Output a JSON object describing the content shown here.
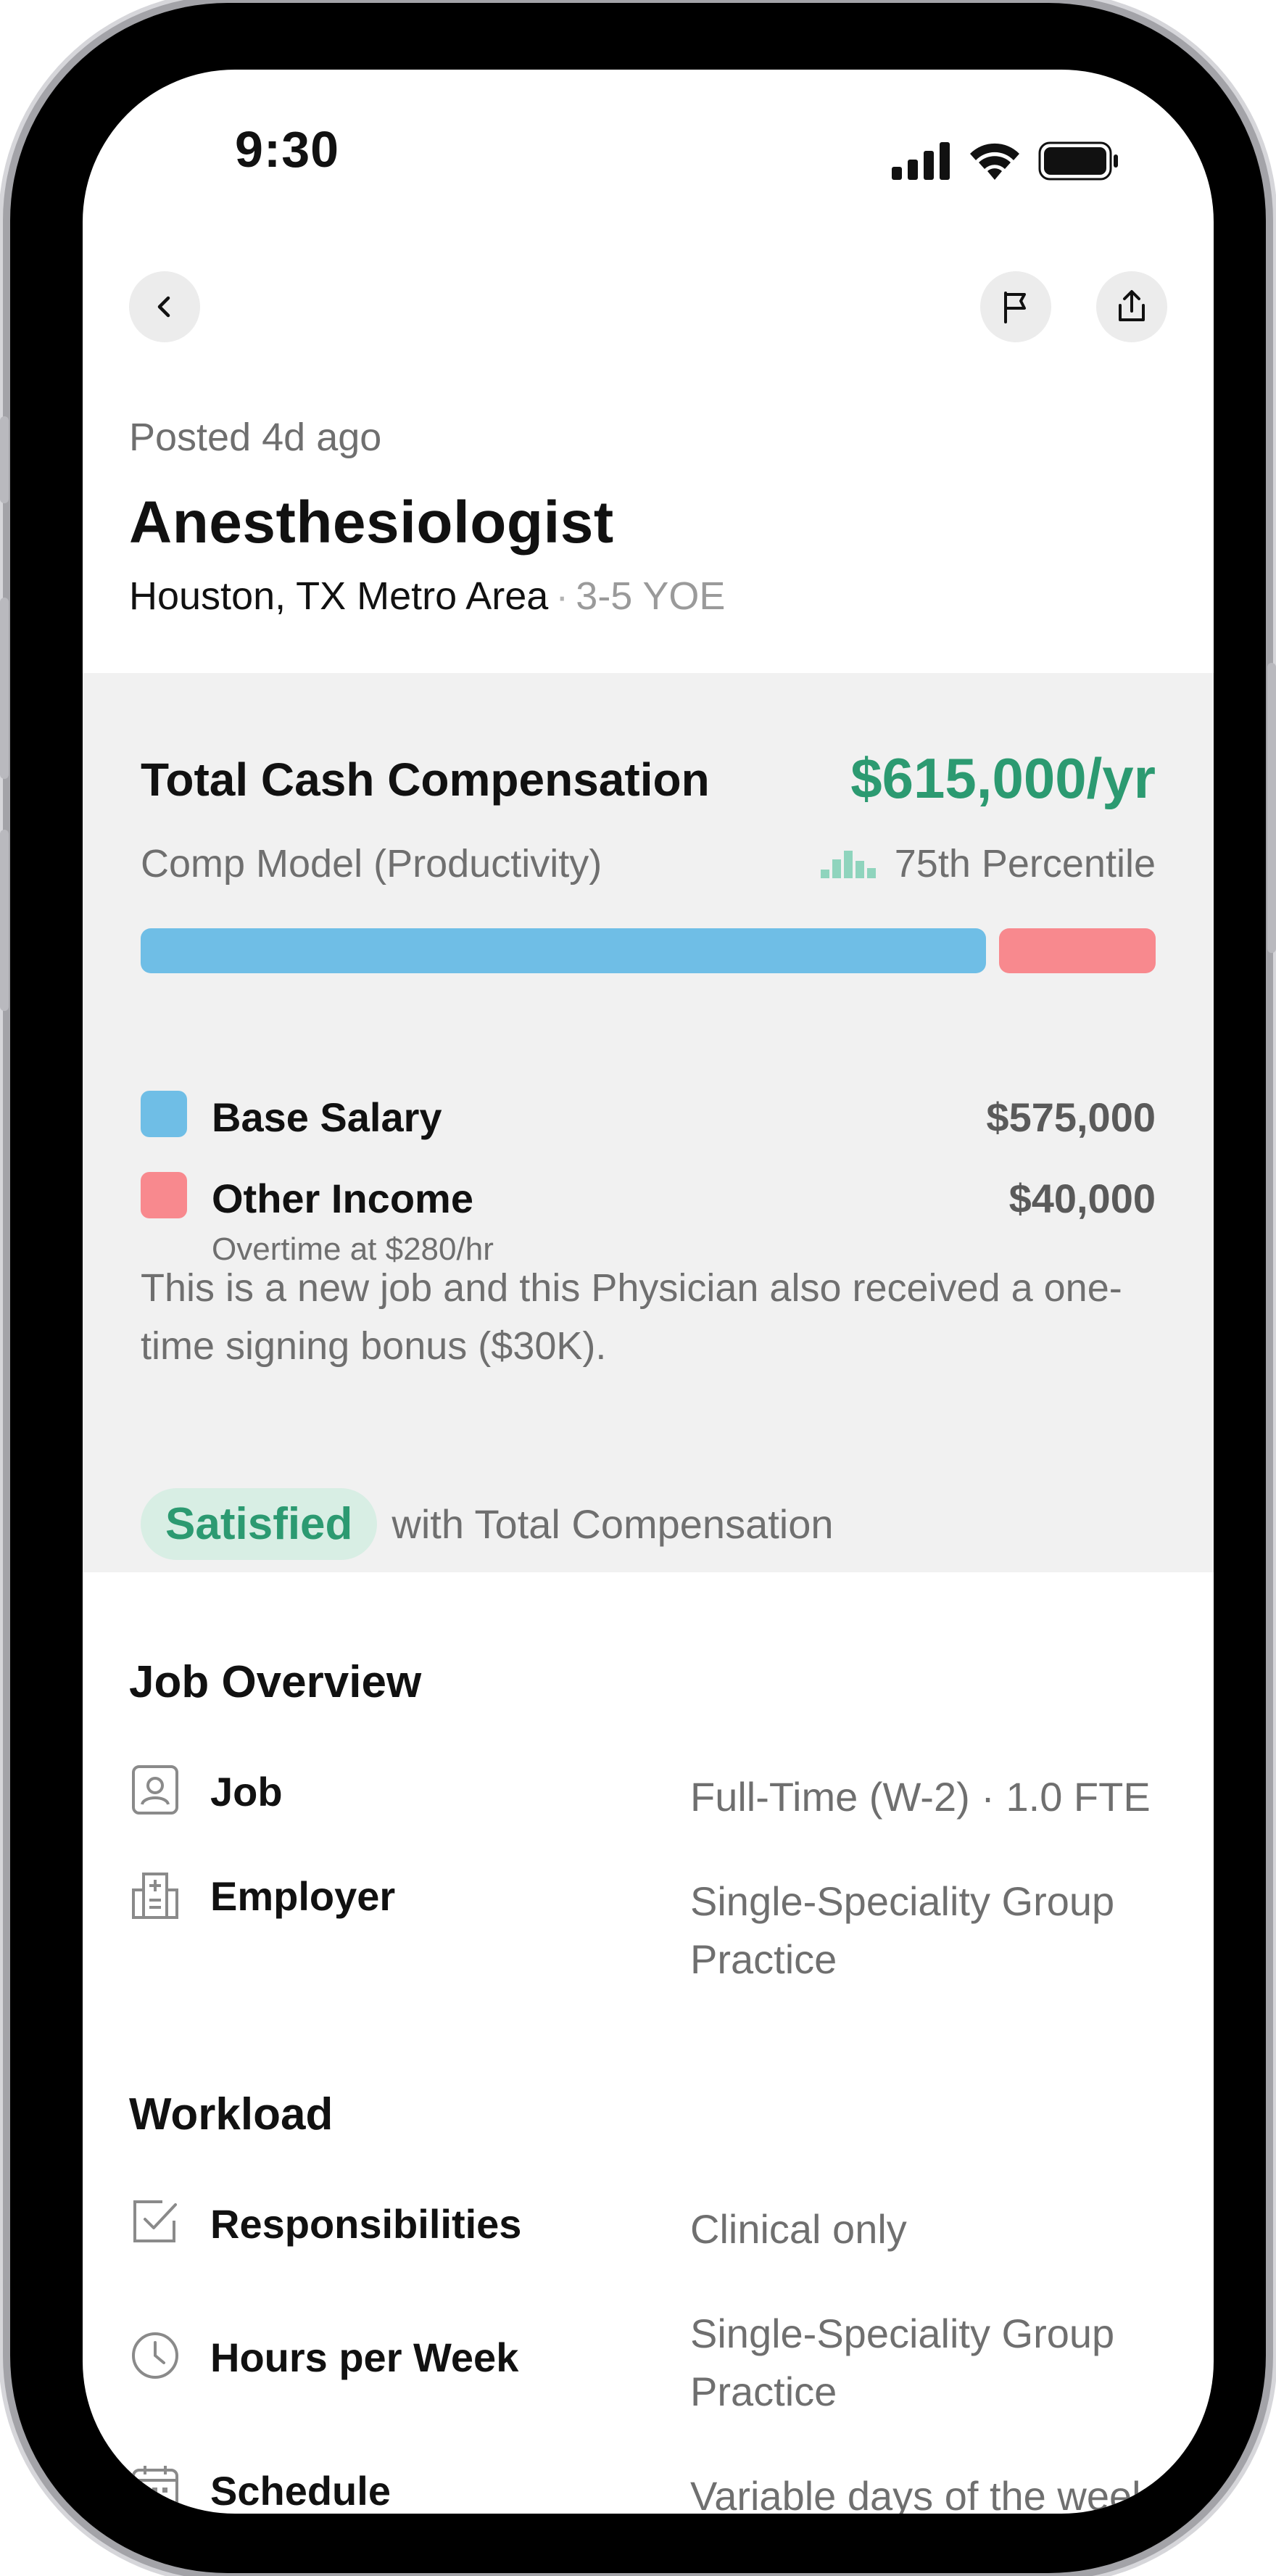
{
  "status_bar": {
    "time": "9:30"
  },
  "nav": {
    "back_icon": "chevron-left-icon",
    "flag_icon": "flag-icon",
    "share_icon": "share-icon"
  },
  "header": {
    "posted": "Posted 4d ago",
    "title": "Anesthesiologist",
    "location": "Houston, TX Metro Area",
    "separator": "·",
    "experience": "3-5 YOE"
  },
  "compensation": {
    "title": "Total Cash Compensation",
    "amount": "$615,000/yr",
    "model": "Comp Model (Productivity)",
    "percentile": "75th Percentile",
    "colors": {
      "base": "#6fbee6",
      "other": "#f8898e",
      "accent": "#2c9a71",
      "percentile_icon": "#8fd4bd"
    },
    "breakdown": {
      "base_share": 0.8438,
      "other_share": 0.1562
    },
    "items": [
      {
        "label": "Base Salary",
        "sublabel": "",
        "value": "$575,000"
      },
      {
        "label": "Other Income",
        "sublabel": "Overtime at $280/hr",
        "value": "$40,000"
      }
    ],
    "note": "This is a new job and this Physician also received a one-time signing bonus ($30K).",
    "satisfaction_badge": "Satisfied",
    "satisfaction_text": "with Total Compensation"
  },
  "job_overview": {
    "title": "Job Overview",
    "rows": [
      {
        "icon": "id-badge-icon",
        "label": "Job",
        "value": "Full-Time (W-2) · 1.0 FTE"
      },
      {
        "icon": "hospital-building-icon",
        "label": "Employer",
        "value": "Single-Speciality Group Practice"
      }
    ]
  },
  "workload": {
    "title": "Workload",
    "rows": [
      {
        "icon": "checkbox-icon",
        "label": "Responsibilities",
        "value": "Clinical only"
      },
      {
        "icon": "clock-icon",
        "label": "Hours per Week",
        "value": "Single-Speciality Group Practice"
      },
      {
        "icon": "calendar-icon",
        "label": "Schedule",
        "value": "Variable days of the week, day & night shifts, variable"
      }
    ]
  }
}
